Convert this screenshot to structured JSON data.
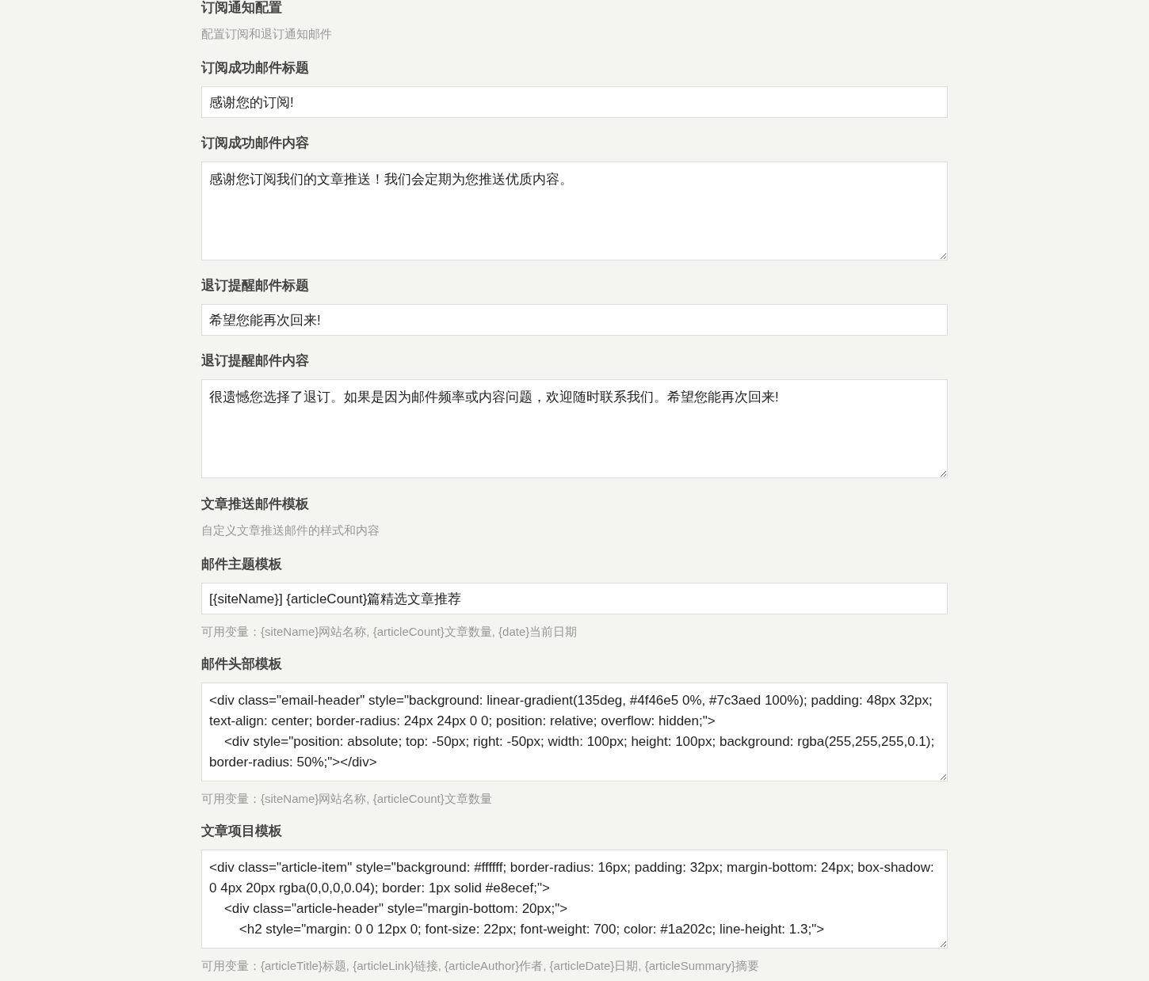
{
  "sections": [
    {
      "title": "订阅通知配置",
      "description": "配置订阅和退订通知邮件",
      "fields": [
        {
          "kind": "input",
          "label": "订阅成功邮件标题",
          "value": "感谢您的订阅!"
        },
        {
          "kind": "textarea",
          "label": "订阅成功邮件内容",
          "value": "感谢您订阅我们的文章推送！我们会定期为您推送优质内容。"
        },
        {
          "kind": "input",
          "label": "退订提醒邮件标题",
          "value": "希望您能再次回来!"
        },
        {
          "kind": "textarea",
          "label": "退订提醒邮件内容",
          "value": "很遗憾您选择了退订。如果是因为邮件频率或内容问题，欢迎随时联系我们。希望您能再次回来!"
        }
      ]
    },
    {
      "title": "文章推送邮件模板",
      "description": "自定义文章推送邮件的样式和内容",
      "fields": [
        {
          "kind": "input",
          "label": "邮件主题模板",
          "value": "[{siteName}] {articleCount}篇精选文章推荐",
          "hint": "可用变量：{siteName}网站名称, {articleCount}文章数量, {date}当前日期"
        },
        {
          "kind": "textarea",
          "label": "邮件头部模板",
          "value": "<div class=\"email-header\" style=\"background: linear-gradient(135deg, #4f46e5 0%, #7c3aed 100%); padding: 48px 32px; text-align: center; border-radius: 24px 24px 0 0; position: relative; overflow: hidden;\">\n    <div style=\"position: absolute; top: -50px; right: -50px; width: 100px; height: 100px; background: rgba(255,255,255,0.1); border-radius: 50%;\"></div>",
          "hint": "可用变量：{siteName}网站名称, {articleCount}文章数量"
        },
        {
          "kind": "textarea",
          "label": "文章项目模板",
          "value": "<div class=\"article-item\" style=\"background: #ffffff; border-radius: 16px; padding: 32px; margin-bottom: 24px; box-shadow: 0 4px 20px rgba(0,0,0,0.04); border: 1px solid #e8ecef;\">\n    <div class=\"article-header\" style=\"margin-bottom: 20px;\">\n        <h2 style=\"margin: 0 0 12px 0; font-size: 22px; font-weight: 700; color: #1a202c; line-height: 1.3;\">",
          "hint": "可用变量：{articleTitle}标题, {articleLink}链接, {articleAuthor}作者, {articleDate}日期, {articleSummary}摘要"
        }
      ]
    }
  ]
}
